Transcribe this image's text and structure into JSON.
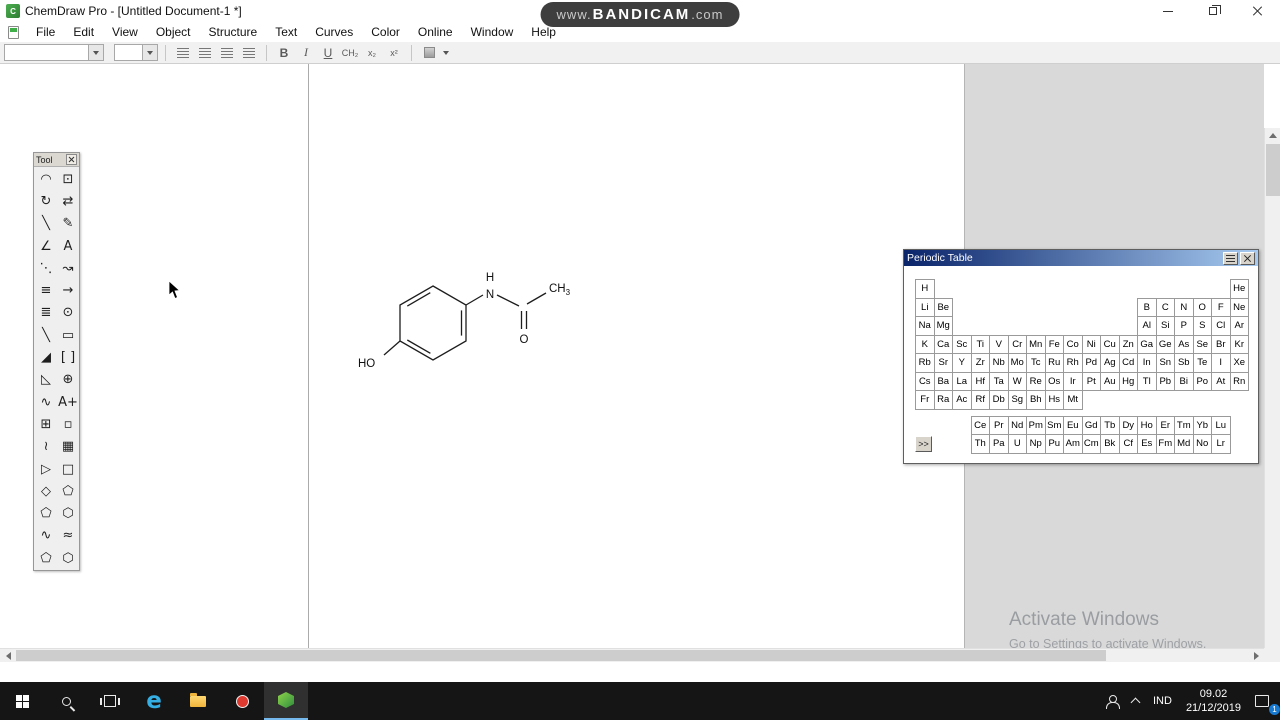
{
  "window": {
    "title": "ChemDraw Pro - [Untitled Document-1 *]"
  },
  "watermark": {
    "prefix": "www.",
    "brand": "BANDICAM",
    "suffix": ".com"
  },
  "menu": {
    "items": [
      "File",
      "Edit",
      "View",
      "Object",
      "Structure",
      "Text",
      "Curves",
      "Color",
      "Online",
      "Window",
      "Help"
    ]
  },
  "toolbar": {
    "bold": "B",
    "italic": "I",
    "underline": "U",
    "formula": "CH₂",
    "subscript": "x₂",
    "superscript": "x²"
  },
  "tool_palette": {
    "title": "Tool",
    "tools": [
      {
        "name": "lasso-tool",
        "glyph": "◠"
      },
      {
        "name": "marquee-tool",
        "glyph": "⊡"
      },
      {
        "name": "rotate-tool",
        "glyph": "↻"
      },
      {
        "name": "flip-tool",
        "glyph": "⇄"
      },
      {
        "name": "solid-bond-tool",
        "glyph": "╲"
      },
      {
        "name": "eraser-pencil-tool",
        "glyph": "✎"
      },
      {
        "name": "multiple-bond-tool",
        "glyph": "∠"
      },
      {
        "name": "text-tool",
        "glyph": "A"
      },
      {
        "name": "dashed-bond-tool",
        "glyph": "⋱"
      },
      {
        "name": "pen-tool",
        "glyph": "↝"
      },
      {
        "name": "hashed-bond-tool",
        "glyph": "≡"
      },
      {
        "name": "arrow-tool",
        "glyph": "→"
      },
      {
        "name": "hashed-wedge-bond-tool",
        "glyph": "≣"
      },
      {
        "name": "orbital-tool",
        "glyph": "⊙"
      },
      {
        "name": "bold-bond-tool",
        "glyph": "╲",
        "bold": true
      },
      {
        "name": "drawing-rectangle-tool",
        "glyph": "▭"
      },
      {
        "name": "wedge-bond-tool",
        "glyph": "◢"
      },
      {
        "name": "bracket-tool",
        "glyph": "[ ]"
      },
      {
        "name": "hollow-wedge-bond-tool",
        "glyph": "◺"
      },
      {
        "name": "chemical-symbol-tool",
        "glyph": "⊕"
      },
      {
        "name": "wavy-bond-tool",
        "glyph": "∿"
      },
      {
        "name": "atom-label-tool",
        "glyph": "A+"
      },
      {
        "name": "table-tool",
        "glyph": "⊞"
      },
      {
        "name": "structure-frame-tool",
        "glyph": "▫"
      },
      {
        "name": "chain-tool",
        "glyph": "≀"
      },
      {
        "name": "templates-tool",
        "glyph": "▦"
      },
      {
        "name": "cyclopropane-ring-tool",
        "glyph": "▷"
      },
      {
        "name": "cyclobutane-ring-tool",
        "glyph": "□"
      },
      {
        "name": "diamond-ring-tool",
        "glyph": "◇"
      },
      {
        "name": "cyclopentane-ring-tool",
        "glyph": "⬠"
      },
      {
        "name": "pentagon-ring-tool",
        "glyph": "⬠"
      },
      {
        "name": "cyclohexane-ring-tool",
        "glyph": "⬡"
      },
      {
        "name": "chair-template-tool",
        "glyph": "∿"
      },
      {
        "name": "chair-template-2-tool",
        "glyph": "≈"
      },
      {
        "name": "cyclopentadiene-template-tool",
        "glyph": "⬠"
      },
      {
        "name": "benzene-template-tool",
        "glyph": "⬡"
      }
    ]
  },
  "structure": {
    "labels": {
      "ho": "HO",
      "n": "N",
      "h": "H",
      "o": "O",
      "ch": "CH",
      "sub": "3"
    }
  },
  "periodic_table": {
    "title": "Periodic Table",
    "more_button": ">>",
    "rows": [
      [
        "H",
        "",
        "",
        "",
        "",
        "",
        "",
        "",
        "",
        "",
        "",
        "",
        "",
        "",
        "",
        "",
        "",
        "He"
      ],
      [
        "Li",
        "Be",
        "",
        "",
        "",
        "",
        "",
        "",
        "",
        "",
        "",
        "",
        "B",
        "C",
        "N",
        "O",
        "F",
        "Ne"
      ],
      [
        "Na",
        "Mg",
        "",
        "",
        "",
        "",
        "",
        "",
        "",
        "",
        "",
        "",
        "Al",
        "Si",
        "P",
        "S",
        "Cl",
        "Ar"
      ],
      [
        "K",
        "Ca",
        "Sc",
        "Ti",
        "V",
        "Cr",
        "Mn",
        "Fe",
        "Co",
        "Ni",
        "Cu",
        "Zn",
        "Ga",
        "Ge",
        "As",
        "Se",
        "Br",
        "Kr"
      ],
      [
        "Rb",
        "Sr",
        "Y",
        "Zr",
        "Nb",
        "Mo",
        "Tc",
        "Ru",
        "Rh",
        "Pd",
        "Ag",
        "Cd",
        "In",
        "Sn",
        "Sb",
        "Te",
        "I",
        "Xe"
      ],
      [
        "Cs",
        "Ba",
        "La",
        "Hf",
        "Ta",
        "W",
        "Re",
        "Os",
        "Ir",
        "Pt",
        "Au",
        "Hg",
        "Tl",
        "Pb",
        "Bi",
        "Po",
        "At",
        "Rn"
      ],
      [
        "Fr",
        "Ra",
        "Ac",
        "Rf",
        "Db",
        "Sg",
        "Bh",
        "Hs",
        "Mt",
        "",
        "",
        "",
        "",
        "",
        "",
        "",
        "",
        ""
      ]
    ],
    "f_rows": [
      [
        "",
        "",
        "",
        "Ce",
        "Pr",
        "Nd",
        "Pm",
        "Sm",
        "Eu",
        "Gd",
        "Tb",
        "Dy",
        "Ho",
        "Er",
        "Tm",
        "Yb",
        "Lu",
        ""
      ],
      [
        "",
        "",
        "",
        "Th",
        "Pa",
        "U",
        "Np",
        "Pu",
        "Am",
        "Cm",
        "Bk",
        "Cf",
        "Es",
        "Fm",
        "Md",
        "No",
        "Lr",
        ""
      ]
    ]
  },
  "activate": {
    "line1": "Activate Windows",
    "line2": "Go to Settings to activate Windows."
  },
  "taskbar": {
    "edge_glyph": "e",
    "language": "IND",
    "time": "09.02",
    "date": "21/12/2019",
    "notification_count": "1"
  }
}
